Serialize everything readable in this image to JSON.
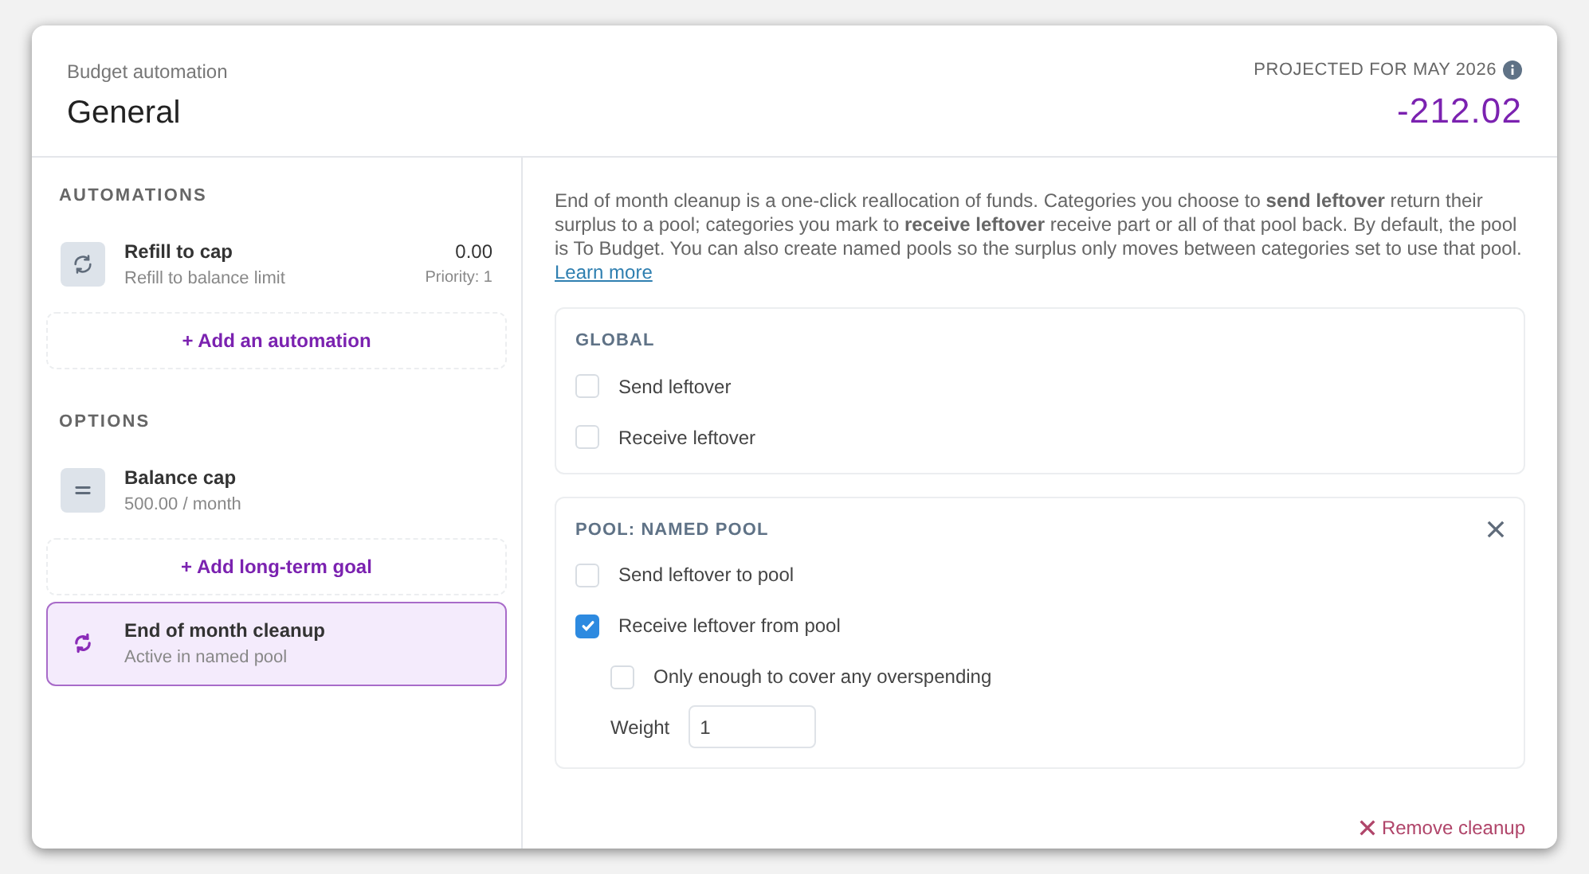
{
  "header": {
    "subtitle": "Budget automation",
    "title": "General",
    "projection_label": "PROJECTED FOR MAY 2026",
    "projection_value": "-212.02"
  },
  "sidebar": {
    "automations": {
      "heading": "AUTOMATIONS",
      "items": [
        {
          "kind": "refresh",
          "title": "Refill to cap",
          "subtitle": "Refill to balance limit",
          "amount": "0.00",
          "priority": "Priority: 1",
          "selected": false
        }
      ],
      "add_label": "+ Add an automation"
    },
    "options": {
      "heading": "OPTIONS",
      "items": [
        {
          "kind": "equals",
          "title": "Balance cap",
          "subtitle": "500.00 / month",
          "selected": false
        }
      ],
      "add_label": "+ Add long-term goal",
      "extra_items": [
        {
          "kind": "cycle",
          "title": "End of month cleanup",
          "subtitle": "Active in named pool",
          "selected": true
        }
      ]
    }
  },
  "description": {
    "text": "End of month cleanup is a one-click reallocation of funds. Categories you choose to **send leftover** return their surplus to a pool; categories you mark to **receive leftover** receive part or all of that pool back. By default, the pool is To Budget. You can also create named pools so the surplus only moves between categories set to use that pool.",
    "link": "Learn more"
  },
  "sections": [
    {
      "heading": "GLOBAL",
      "closable": false,
      "options": [
        {
          "label": "Send leftover",
          "checked": false
        },
        {
          "label": "Receive leftover",
          "checked": false
        }
      ]
    },
    {
      "heading": "POOL: NAMED POOL",
      "closable": true,
      "options": [
        {
          "label": "Send leftover to pool",
          "checked": false
        },
        {
          "label": "Receive leftover from pool",
          "checked": true,
          "children": [
            {
              "label": "Only enough to cover any overspending",
              "checked": false
            }
          ]
        }
      ],
      "weight": {
        "label": "Weight",
        "value": "1"
      }
    }
  ],
  "remove_button": "Remove cleanup"
}
